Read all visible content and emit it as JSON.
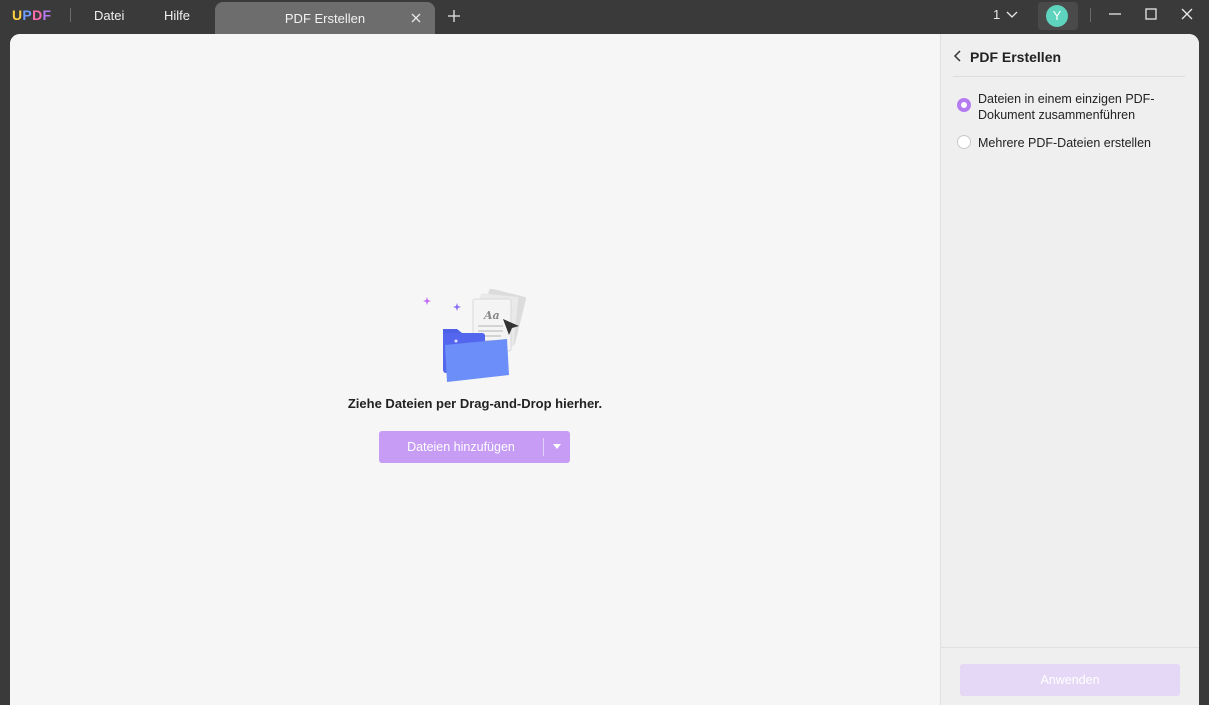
{
  "app": {
    "logo_letters": [
      "U",
      "P",
      "D",
      "F"
    ],
    "logo_colors": [
      "#ffd23f",
      "#6f9cff",
      "#ff6fb0",
      "#b57cf1"
    ]
  },
  "menu": {
    "file": "Datei",
    "help": "Hilfe"
  },
  "tab": {
    "label": "PDF Erstellen",
    "close_icon": "close-icon",
    "add_icon": "plus-icon"
  },
  "header_right": {
    "page_number": "1",
    "avatar_letter": "Y"
  },
  "window_controls": [
    "minimize-icon",
    "maximize-icon",
    "close-icon"
  ],
  "dropzone": {
    "text": "Ziehe Dateien per Drag-and-Drop hierher.",
    "add_button": "Dateien hinzufügen",
    "illustration_text": "Aa"
  },
  "panel": {
    "title": "PDF Erstellen",
    "options": [
      {
        "label_line1": "Dateien in einem einzigen PDF-",
        "label_line2": "Dokument zusammenführen",
        "selected": true
      },
      {
        "label_line1": "Mehrere PDF-Dateien erstellen",
        "selected": false
      }
    ],
    "apply_button": "Anwenden"
  },
  "colors": {
    "accent": "#b57cf1",
    "button": "#c69cf5",
    "apply_disabled": "#e5d8f7",
    "avatar": "#5ed3bd"
  }
}
